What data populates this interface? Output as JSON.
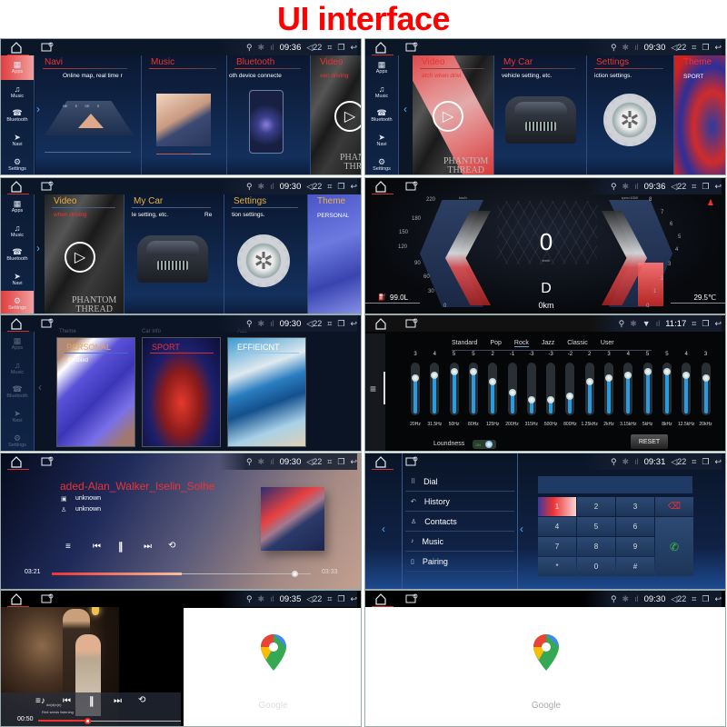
{
  "title": "UI interface",
  "status": {
    "p1_time": "09:36",
    "p2_time": "09:30",
    "p3_time": "09:30",
    "p4_time": "09:36",
    "p5_time": "09:30",
    "p6_time": "11:17",
    "p7_time": "09:30",
    "p8_time": "09:31",
    "p9_time": "09:35",
    "p10_time": "09:30",
    "volume": "22"
  },
  "icons": {
    "home": "home-icon",
    "card": "card-icon",
    "usb": "usb-icon",
    "bluetooth": "bluetooth-icon",
    "signal": "signal-icon",
    "volume": "volume-icon",
    "fullscreen": "fullscreen-icon",
    "windows": "recent-apps-icon",
    "back": "back-icon"
  },
  "sidenav": [
    {
      "label": "Apps",
      "glyph": "▦"
    },
    {
      "label": "Music",
      "glyph": "♫"
    },
    {
      "label": "Bluetooth",
      "glyph": "☎"
    },
    {
      "label": "Navi",
      "glyph": "➤"
    },
    {
      "label": "Settings",
      "glyph": "⚙"
    }
  ],
  "home1": {
    "cards": [
      {
        "title": "Navi",
        "desc": "Online map, real time r"
      },
      {
        "title": "Music",
        "desc": ""
      },
      {
        "title": "Bluetooth",
        "desc": "oth device connecte"
      },
      {
        "title": "Video",
        "desc": "ven driving"
      }
    ],
    "compass": [
      "NE",
      "E",
      "SE",
      "S"
    ]
  },
  "home2": {
    "cards": [
      {
        "title": "Video",
        "desc": "atch when drivi"
      },
      {
        "title": "My Car",
        "desc": "vehicle setting, etc."
      },
      {
        "title": "Settings",
        "desc": "iction settings."
      },
      {
        "title": "Theme",
        "desc": "SPORT"
      }
    ],
    "poster_title_1": "PHANTOM",
    "poster_title_2": "THREAD"
  },
  "home3": {
    "cards": [
      {
        "title": "Video",
        "desc": "when driving"
      },
      {
        "title": "My Car",
        "desc": "le setting, etc.",
        "extra": "Re"
      },
      {
        "title": "Settings",
        "desc": "tion settings."
      },
      {
        "title": "Theme",
        "desc": "PERSONAL"
      }
    ]
  },
  "cluster": {
    "speed": "0",
    "speed_unit": "km/h",
    "gear": "D",
    "odometer": "0km",
    "fuel": "99.0L",
    "temperature": "29.5℃",
    "speed_ticks": [
      "220",
      "180",
      "150",
      "120",
      "90",
      "60",
      "30",
      "0"
    ],
    "speed_scale_label": "km/h",
    "rpm_ticks": [
      "8",
      "7",
      "6",
      "5",
      "4",
      "3",
      "2",
      "1",
      "0"
    ],
    "rpm_scale_label": "rpm×1000",
    "rpm_level": 3.3
  },
  "themes": {
    "background_tabs": [
      "Theme",
      "Car info",
      "Add"
    ],
    "cards": [
      {
        "title": "PERSONAL",
        "status": "Enabled"
      },
      {
        "title": "SPORT",
        "status": ""
      },
      {
        "title": "EFFIEICNT",
        "status": ""
      }
    ]
  },
  "equalizer": {
    "presets": [
      "Standard",
      "Pop",
      "Rock",
      "Jazz",
      "Classic",
      "User"
    ],
    "active_preset": "Rock",
    "bands": [
      {
        "freq": "20Hz",
        "value": 3
      },
      {
        "freq": "31.5Hz",
        "value": 4
      },
      {
        "freq": "50Hz",
        "value": 5
      },
      {
        "freq": "80Hz",
        "value": 5
      },
      {
        "freq": "125Hz",
        "value": 2
      },
      {
        "freq": "200Hz",
        "value": -1
      },
      {
        "freq": "315Hz",
        "value": -3
      },
      {
        "freq": "500Hz",
        "value": -3
      },
      {
        "freq": "800Hz",
        "value": -2
      },
      {
        "freq": "1.25kHz",
        "value": 2
      },
      {
        "freq": "2kHz",
        "value": 3
      },
      {
        "freq": "3.15kHz",
        "value": 4
      },
      {
        "freq": "5kHz",
        "value": 5
      },
      {
        "freq": "8kHz",
        "value": 5
      },
      {
        "freq": "12.5kHz",
        "value": 4
      },
      {
        "freq": "20kHz",
        "value": 3
      }
    ],
    "range": [
      -7,
      7
    ],
    "loudness_label": "Loundness",
    "loudness_state": "ON",
    "reset_label": "RESET"
  },
  "music": {
    "track": "aded-Alan_Walker_Iselin_Solhe",
    "album": "unknown",
    "artist": "unknown",
    "elapsed": "03:21",
    "total": "03:33",
    "progress": 0.94,
    "buffered": 0.5
  },
  "phone": {
    "menu": [
      {
        "label": "Dial",
        "glyph": "⠿"
      },
      {
        "label": "History",
        "glyph": "↶"
      },
      {
        "label": "Contacts",
        "glyph": "♙"
      },
      {
        "label": "Music",
        "glyph": "♪"
      },
      {
        "label": "Pairing",
        "glyph": "▯"
      }
    ],
    "keys": [
      "1",
      "2",
      "3",
      "⌫",
      "4",
      "5",
      "6",
      "📞",
      "7",
      "8",
      "9",
      "*",
      "0",
      "#"
    ],
    "active_key": "1",
    "number_display": ""
  },
  "video": {
    "elapsed": "00:50",
    "progress": 0.35,
    "subtitle_1": "dd(d)e(e)",
    "subtitle_2": "Red seeds listening"
  },
  "maps": {
    "brand": "Google"
  },
  "colors": {
    "accent_red": "#e33333",
    "accent_blue": "#2a9be0",
    "theme_gold": "#e8b23e",
    "title_red": "#ff0000"
  }
}
